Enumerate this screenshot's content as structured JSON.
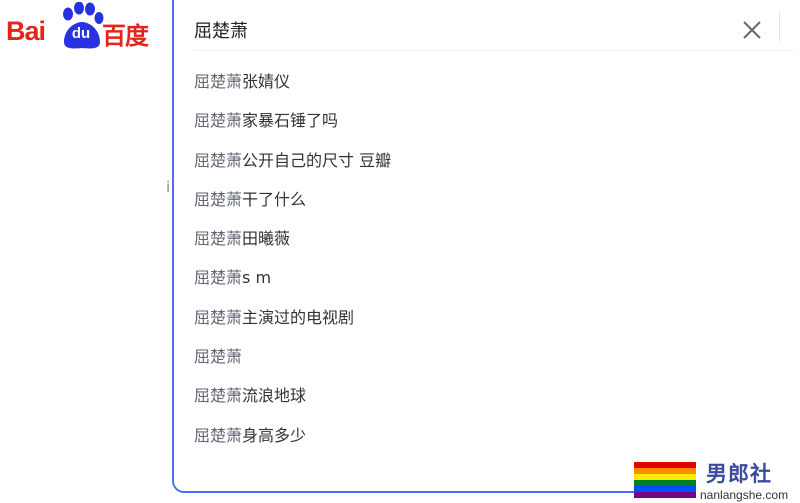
{
  "logo": {
    "bai": "Bai",
    "du": "du",
    "cn": "百度"
  },
  "stray_glyph": "i",
  "search": {
    "query": "屈楚萧",
    "placeholder": ""
  },
  "suggestions": [
    {
      "prefix": "屈楚萧",
      "suffix": "张婧仪"
    },
    {
      "prefix": "屈楚萧",
      "suffix": "家暴石锤了吗"
    },
    {
      "prefix": "屈楚萧",
      "suffix": "公开自己的尺寸 豆瓣"
    },
    {
      "prefix": "屈楚萧",
      "suffix": "干了什么"
    },
    {
      "prefix": "屈楚萧",
      "suffix": "田曦薇"
    },
    {
      "prefix": "屈楚萧",
      "suffix": "s m"
    },
    {
      "prefix": "屈楚萧",
      "suffix": "主演过的电视剧"
    },
    {
      "prefix": "屈楚萧",
      "suffix": ""
    },
    {
      "prefix": "屈楚萧",
      "suffix": "流浪地球"
    },
    {
      "prefix": "屈楚萧",
      "suffix": "身高多少"
    }
  ],
  "watermark": {
    "title": "男郎社",
    "url": "nanlangshe.com"
  },
  "colors": {
    "brand_red": "#e1251b",
    "brand_blue": "#2932e1",
    "focus_border": "#4e6ef2",
    "suggestion_prefix": "#626675",
    "suggestion_text": "#333333",
    "flag": [
      "#e40303",
      "#ff8c00",
      "#ffed00",
      "#008026",
      "#004dff",
      "#750787"
    ]
  },
  "icons": {
    "clear": "close-icon",
    "logo_paw": "baidu-paw-icon",
    "watermark_flag": "rainbow-flag-icon"
  }
}
